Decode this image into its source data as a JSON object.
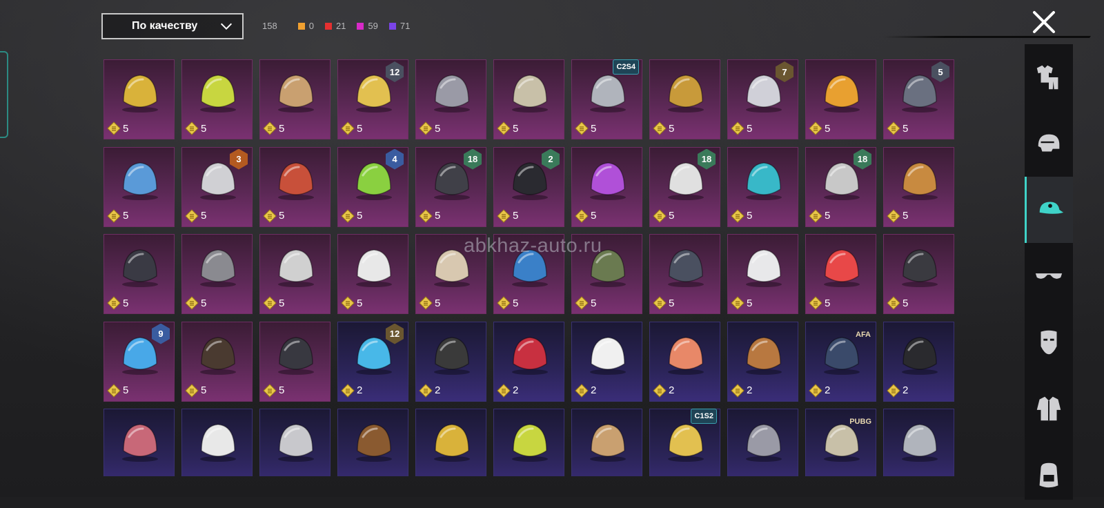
{
  "filter": {
    "label": "По качеству"
  },
  "counts": {
    "total": "158",
    "items": [
      {
        "color": "#f0a030",
        "value": "0"
      },
      {
        "color": "#e53030",
        "value": "21"
      },
      {
        "color": "#d82ac8",
        "value": "59"
      },
      {
        "color": "#7a44e8",
        "value": "71"
      }
    ]
  },
  "watermark": "abkhaz-auto.ru",
  "colors": {
    "accent": "#3fd3c8",
    "legendary_card": "#7a3171",
    "epic_card": "#3a2d78"
  },
  "grid": {
    "rows": [
      [
        {
          "price": "5",
          "rarity": "r5",
          "icon": "duck-mask-icon"
        },
        {
          "price": "5",
          "rarity": "r5",
          "icon": "bucket-hat-icon"
        },
        {
          "price": "5",
          "rarity": "r5",
          "icon": "straw-hat-icon"
        },
        {
          "price": "5",
          "rarity": "r5",
          "icon": "box-head-icon",
          "badge": "12",
          "badge_type": "hex"
        },
        {
          "price": "5",
          "rarity": "r5",
          "icon": "knight-helmet-icon"
        },
        {
          "price": "5",
          "rarity": "r5",
          "icon": "pharaoh-mask-icon"
        },
        {
          "price": "5",
          "rarity": "r5",
          "icon": "silver-wig-icon",
          "badge": "C2S4",
          "badge_type": "tag"
        },
        {
          "price": "5",
          "rarity": "r5",
          "icon": "golden-helmet-icon"
        },
        {
          "price": "5",
          "rarity": "r5",
          "icon": "sultan-hat-icon",
          "badge": "7",
          "badge_type": "hex gold"
        },
        {
          "price": "5",
          "rarity": "r5",
          "icon": "spiked-mask-icon"
        },
        {
          "price": "5",
          "rarity": "r5",
          "icon": "witch-hat-icon",
          "badge": "5",
          "badge_type": "hex"
        }
      ],
      [
        {
          "price": "5",
          "rarity": "r5",
          "icon": "kendo-helmet-icon"
        },
        {
          "price": "5",
          "rarity": "r5",
          "icon": "cyber-hat-icon",
          "badge": "3",
          "badge_type": "hex orange"
        },
        {
          "price": "5",
          "rarity": "r5",
          "icon": "white-hair-icon"
        },
        {
          "price": "5",
          "rarity": "r5",
          "icon": "oni-mask-icon",
          "badge": "4",
          "badge_type": "hex blue"
        },
        {
          "price": "5",
          "rarity": "r5",
          "icon": "feather-cap-icon",
          "badge": "18",
          "badge_type": "hex green"
        },
        {
          "price": "5",
          "rarity": "r5",
          "icon": "predator-mask-icon",
          "badge": "2",
          "badge_type": "hex green"
        },
        {
          "price": "5",
          "rarity": "r5",
          "icon": "bun-hair-icon"
        },
        {
          "price": "5",
          "rarity": "r5",
          "icon": "carousel-hat-icon",
          "badge": "18",
          "badge_type": "hex green"
        },
        {
          "price": "5",
          "rarity": "r5",
          "icon": "fedora-icon"
        },
        {
          "price": "5",
          "rarity": "r5",
          "icon": "headphone-cap-icon",
          "badge": "18",
          "badge_type": "hex green"
        },
        {
          "price": "5",
          "rarity": "r5",
          "icon": "lion-mask-icon"
        }
      ],
      [
        {
          "price": "5",
          "rarity": "r5",
          "icon": "camel-mask-icon"
        },
        {
          "price": "5",
          "rarity": "r5",
          "icon": "feather-beret-icon"
        },
        {
          "price": "5",
          "rarity": "r5",
          "icon": "wolf-mask-icon"
        },
        {
          "price": "5",
          "rarity": "r5",
          "icon": "rabbit-mask-icon"
        },
        {
          "price": "5",
          "rarity": "r5",
          "icon": "zebra-mask-icon"
        },
        {
          "price": "5",
          "rarity": "r5",
          "icon": "zeus-mask-icon"
        },
        {
          "price": "5",
          "rarity": "r5",
          "icon": "racing-helmet-icon"
        },
        {
          "price": "5",
          "rarity": "r5",
          "icon": "military-helmet-icon"
        },
        {
          "price": "5",
          "rarity": "r5",
          "icon": "swat-helmet-icon"
        },
        {
          "price": "5",
          "rarity": "r5",
          "icon": "beanie-icon"
        },
        {
          "price": "5",
          "rarity": "r5",
          "icon": "crab-hat-icon"
        }
      ],
      [
        {
          "price": "5",
          "rarity": "r5",
          "icon": "conical-hat-icon",
          "badge": "9",
          "badge_type": "hex blue"
        },
        {
          "price": "5",
          "rarity": "r5",
          "icon": "spiky-mask-icon"
        },
        {
          "price": "5",
          "rarity": "r5",
          "icon": "top-hat-icon"
        },
        {
          "price": "2",
          "rarity": "r2",
          "icon": "bunny-helmet-icon",
          "badge": "12",
          "badge_type": "hex gold"
        },
        {
          "price": "2",
          "rarity": "r2",
          "icon": "baseball-cap-icon"
        },
        {
          "price": "2",
          "rarity": "r2",
          "icon": "gas-mask-helmet-icon"
        },
        {
          "price": "2",
          "rarity": "r2",
          "icon": "visor-helmet-icon"
        },
        {
          "price": "2",
          "rarity": "r2",
          "icon": "goggles-hair-icon"
        },
        {
          "price": "2",
          "rarity": "r2",
          "icon": "armored-hood-icon"
        },
        {
          "price": "2",
          "rarity": "r2",
          "icon": "blue-cap-icon",
          "badge": "AFA",
          "badge_type": "plain"
        },
        {
          "price": "2",
          "rarity": "r2",
          "icon": "black-cap-icon"
        }
      ],
      [
        {
          "price": "",
          "rarity": "r2",
          "icon": "bow-hair-icon"
        },
        {
          "price": "",
          "rarity": "r2",
          "icon": "sun-hat-icon"
        },
        {
          "price": "",
          "rarity": "r2",
          "icon": "fox-ears-icon"
        },
        {
          "price": "",
          "rarity": "r2",
          "icon": "bob-hair-icon"
        },
        {
          "price": "",
          "rarity": "r2",
          "icon": "knit-cap-icon"
        },
        {
          "price": "",
          "rarity": "r2",
          "icon": "mesh-cap-icon"
        },
        {
          "price": "",
          "rarity": "r2",
          "icon": "bucket-hat-dark-icon"
        },
        {
          "price": "",
          "rarity": "r2",
          "icon": "headscarf-icon",
          "badge": "C1S2",
          "badge_type": "tag"
        },
        {
          "price": "",
          "rarity": "r2",
          "icon": "flower-hat-icon"
        },
        {
          "price": "",
          "rarity": "r2",
          "icon": "grey-hair-icon",
          "badge": "PUBG",
          "badge_type": "plain"
        },
        {
          "price": "",
          "rarity": "r2",
          "icon": "bandana-hair-icon"
        }
      ]
    ]
  },
  "sidebar": {
    "tabs": [
      {
        "icon": "outfit-icon",
        "active": false
      },
      {
        "icon": "helmet-icon",
        "active": false
      },
      {
        "icon": "cap-icon",
        "active": true
      },
      {
        "icon": "glasses-icon",
        "active": false
      },
      {
        "icon": "mask-icon",
        "active": false
      },
      {
        "icon": "jacket-icon",
        "active": false
      },
      {
        "icon": "backpack-icon",
        "active": false
      }
    ]
  }
}
